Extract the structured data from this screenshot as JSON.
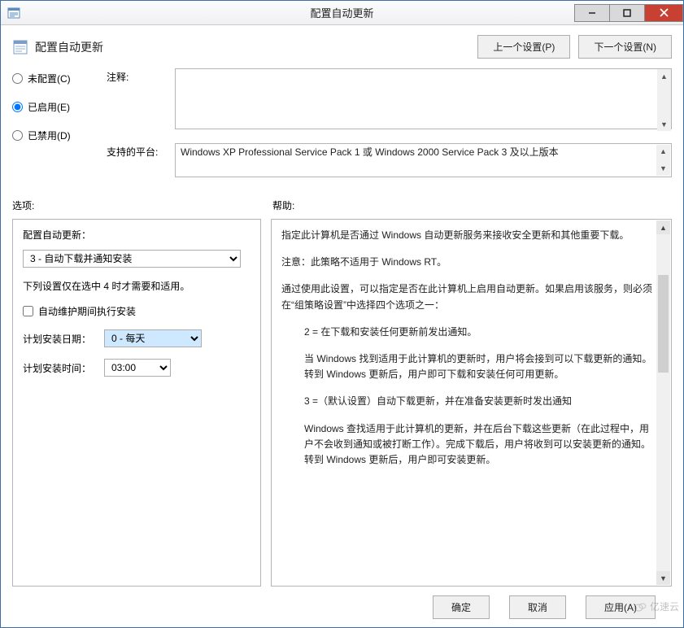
{
  "window": {
    "title": "配置自动更新",
    "icon": "policy-icon"
  },
  "header": {
    "icon": "policy-page-icon",
    "title": "配置自动更新",
    "prev_button": "上一个设置(P)",
    "next_button": "下一个设置(N)"
  },
  "radios": {
    "not_configured": "未配置(C)",
    "enabled": "已启用(E)",
    "disabled": "已禁用(D)",
    "selected": "enabled"
  },
  "fields": {
    "comment_label": "注释:",
    "comment_value": "",
    "platform_label": "支持的平台:",
    "platform_value": "Windows XP Professional Service Pack 1 或 Windows 2000 Service Pack 3 及以上版本"
  },
  "sections": {
    "options": "选项:",
    "help": "帮助:"
  },
  "options": {
    "config_label": "配置自动更新：",
    "config_value": "3 - 自动下载并通知安装",
    "note": "下列设置仅在选中 4 时才需要和适用。",
    "checkbox_label": "自动维护期间执行安装",
    "checkbox_checked": false,
    "schedule_date_label": "计划安装日期：",
    "schedule_date_value": "0 - 每天",
    "schedule_time_label": "计划安装时间：",
    "schedule_time_value": "03:00"
  },
  "help": {
    "p1": "指定此计算机是否通过 Windows 自动更新服务来接收安全更新和其他重要下载。",
    "p2": "注意：此策略不适用于 Windows RT。",
    "p3": "通过使用此设置，可以指定是否在此计算机上启用自动更新。如果启用该服务，则必须在“组策略设置”中选择四个选项之一：",
    "p4": "2 = 在下载和安装任何更新前发出通知。",
    "p5": "当 Windows 找到适用于此计算机的更新时，用户将会接到可以下载更新的通知。转到 Windows 更新后，用户即可下载和安装任何可用更新。",
    "p6": "3 =（默认设置）自动下载更新，并在准备安装更新时发出通知",
    "p7": "Windows 查找适用于此计算机的更新，并在后台下载这些更新（在此过程中，用户不会收到通知或被打断工作）。完成下载后，用户将收到可以安装更新的通知。转到 Windows 更新后，用户即可安装更新。"
  },
  "footer": {
    "ok": "确定",
    "cancel": "取消",
    "apply": "应用(A)"
  },
  "watermark": "亿速云"
}
